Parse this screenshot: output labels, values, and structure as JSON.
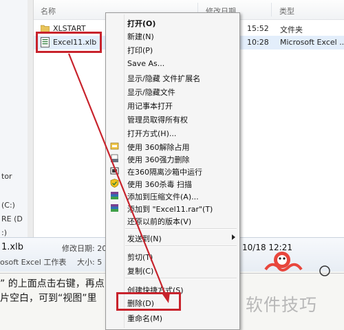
{
  "explorer": {
    "columns": {
      "name": "名称",
      "date": "修改日期",
      "type": "类型"
    },
    "files": [
      {
        "name": "XLSTART",
        "date": "15:52",
        "type": "文件夹"
      },
      {
        "name": "Excel11.xlb",
        "date": "10:28",
        "type": "Microsoft Excel ..."
      }
    ],
    "nav_items": [
      "tor",
      "(C:)",
      "RE (D",
      ":)"
    ]
  },
  "details": {
    "filename": "1.xlb",
    "modified_label": "修改日期: 20",
    "file_type": "osoft Excel 工作表",
    "size_label": "大小: 5",
    "created_value": "10/18 12:21"
  },
  "context_menu": {
    "items": [
      {
        "label": "打开(O)",
        "bold": true
      },
      {
        "label": "新建(N)"
      },
      {
        "label": "打印(P)"
      },
      {
        "label": "Save As..."
      },
      {
        "label": "显示/隐藏 文件扩展名"
      },
      {
        "label": "显示/隐藏文件"
      },
      {
        "label": "用记事本打开"
      },
      {
        "label": "管理员取得所有权"
      },
      {
        "label": "打开方式(H)..."
      },
      {
        "label": "使用 360解除占用"
      },
      {
        "label": "使用 360强力删除"
      },
      {
        "label": "在360隔离沙箱中运行"
      },
      {
        "label": "使用 360杀毒 扫描"
      },
      {
        "label": "添加到压缩文件(A)..."
      },
      {
        "label": "添加到 \"Excel11.rar\"(T)"
      },
      {
        "label": "还原以前的版本(V)"
      },
      {
        "label": "发送到(N)"
      },
      {
        "label": "剪切(T)"
      },
      {
        "label": "复制(C)"
      },
      {
        "label": "创建快捷方式(S)"
      },
      {
        "label": "删除(D)"
      },
      {
        "label": "重命名(M)"
      }
    ]
  },
  "article": {
    "line1": "” 的上面点击右键，再点",
    "line2": "片空白，可到“视图”里"
  },
  "watermark": "软件技巧",
  "colors": {
    "highlight": "#c8232c",
    "selection": "#e3eefb"
  }
}
